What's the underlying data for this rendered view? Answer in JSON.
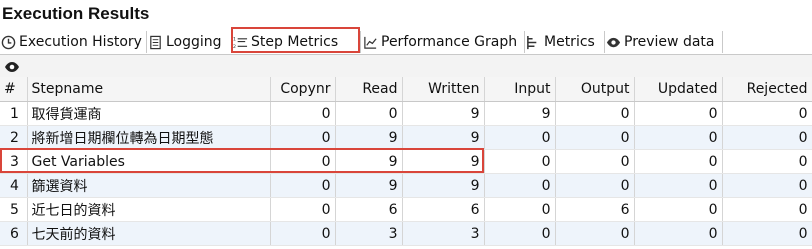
{
  "title": "Execution Results",
  "tabs": [
    {
      "label": "Execution History",
      "icon": "clock-icon"
    },
    {
      "label": "Logging",
      "icon": "document-icon"
    },
    {
      "label": "Step Metrics",
      "icon": "list-icon"
    },
    {
      "label": "Performance Graph",
      "icon": "line-chart-icon"
    },
    {
      "label": "Metrics",
      "icon": "metrics-icon"
    },
    {
      "label": "Preview data",
      "icon": "eye-icon"
    }
  ],
  "active_tab": "Step Metrics",
  "toolbar": {
    "icon": "eye-icon"
  },
  "table": {
    "headers": [
      "#",
      "Stepname",
      "Copynr",
      "Read",
      "Written",
      "Input",
      "Output",
      "Updated",
      "Rejected"
    ],
    "rows": [
      [
        "1",
        "取得貨運商",
        "0",
        "0",
        "9",
        "9",
        "0",
        "0",
        "0"
      ],
      [
        "2",
        "將新增日期欄位轉為日期型態",
        "0",
        "9",
        "9",
        "0",
        "0",
        "0",
        "0"
      ],
      [
        "3",
        "Get Variables",
        "0",
        "9",
        "9",
        "0",
        "0",
        "0",
        "0"
      ],
      [
        "4",
        "篩選資料",
        "0",
        "9",
        "9",
        "0",
        "0",
        "0",
        "0"
      ],
      [
        "5",
        "近七日的資料",
        "0",
        "6",
        "6",
        "0",
        "6",
        "0",
        "0"
      ],
      [
        "6",
        "七天前的資料",
        "0",
        "3",
        "3",
        "0",
        "0",
        "0",
        "0"
      ]
    ]
  },
  "colors": {
    "highlight": "#d9453a",
    "zebra": "#eef4fb",
    "header_bg": "#f5f5f5"
  }
}
